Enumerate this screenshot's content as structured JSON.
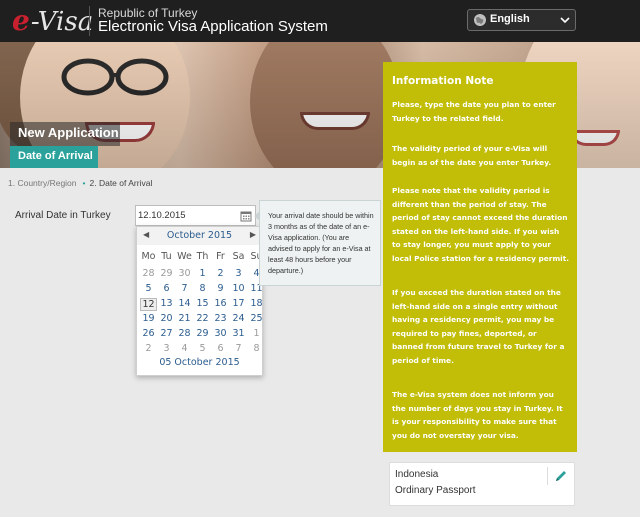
{
  "brand": {
    "logo_e": "e",
    "logo_visa": "-Visa",
    "subtitle": "Republic of Turkey",
    "title": "Electronic Visa Application System"
  },
  "language": {
    "selected": "English",
    "icon": "globe-icon"
  },
  "hero": {
    "title": "New Application",
    "step": "Date of Arrival"
  },
  "breadcrumb": {
    "step1": "1. Country/Region",
    "step2": "2. Date of Arrival"
  },
  "form": {
    "arrival_label": "Arrival Date in Turkey",
    "arrival_value": "12.10.2015"
  },
  "datepicker": {
    "month": "October 2015",
    "weekdays": [
      "Mo",
      "Tu",
      "We",
      "Th",
      "Fr",
      "Sa",
      "Su"
    ],
    "weeks": [
      [
        "28",
        "29",
        "30",
        "1",
        "2",
        "3",
        "4"
      ],
      [
        "5",
        "6",
        "7",
        "8",
        "9",
        "10",
        "11"
      ],
      [
        "12",
        "13",
        "14",
        "15",
        "16",
        "17",
        "18"
      ],
      [
        "19",
        "20",
        "21",
        "22",
        "23",
        "24",
        "25"
      ],
      [
        "26",
        "27",
        "28",
        "29",
        "30",
        "31",
        "1"
      ],
      [
        "2",
        "3",
        "4",
        "5",
        "6",
        "7",
        "8"
      ]
    ],
    "footer": "05 October 2015"
  },
  "tooltip": "Your arrival date should be within 3 months as of the date of an e-Visa application. (You are advised to apply for an e-Visa at least 48 hours before your departure.)",
  "info": {
    "title": "Information Note",
    "p1": "Please, type the date you plan to enter Turkey to the related field.",
    "p2": "The validity period of your e-Visa will begin as of the date you enter Turkey.",
    "p3": "Please note that the validity period is different than the period of stay. The period of stay cannot exceed the duration stated on the left-hand side. If you wish to stay longer, you must apply to your local Police station for a residency permit.",
    "p4": "If you exceed the duration stated on the left-hand side on a single entry without having a residency permit, you may be required to pay fines, deported, or banned from future travel to Turkey for a period of time.",
    "p5": "The e-Visa system does not inform you the number of days you stay in Turkey. It is your responsibility to make sure that you do not overstay your visa."
  },
  "summary": {
    "country": "Indonesia",
    "passport": "Ordinary Passport"
  },
  "colors": {
    "header": "#1f1f1f",
    "accent_teal": "#2aa29b",
    "info_bg": "#c2bd07",
    "logo_red": "#c8202f",
    "link_blue": "#2b5c8f"
  }
}
